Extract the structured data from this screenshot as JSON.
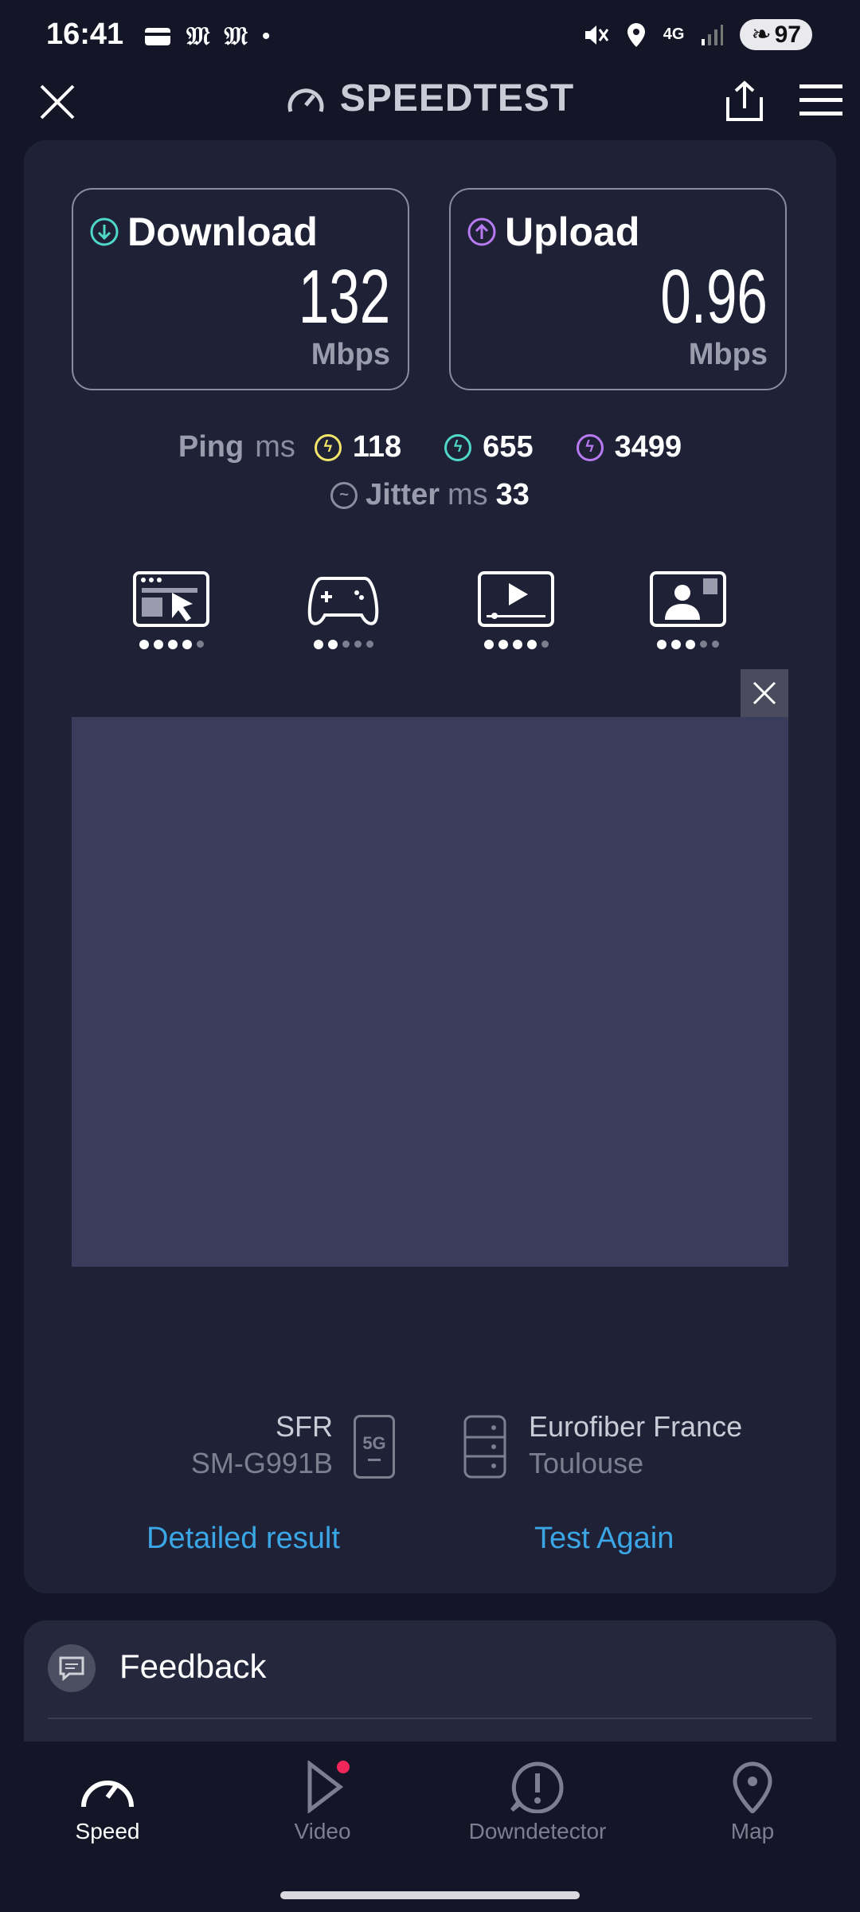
{
  "status": {
    "time": "16:41",
    "battery": "97",
    "network": "4G"
  },
  "header": {
    "title": "SPEEDTEST"
  },
  "download": {
    "label": "Download",
    "value": "132",
    "unit": "Mbps"
  },
  "upload": {
    "label": "Upload",
    "value": "0.96",
    "unit": "Mbps"
  },
  "ping": {
    "label": "Ping",
    "unit": "ms",
    "idle": "118",
    "download": "655",
    "upload": "3499"
  },
  "jitter": {
    "label": "Jitter",
    "unit": "ms",
    "value": "33"
  },
  "quality": {
    "browsing": 4,
    "gaming": 2,
    "streaming": 4,
    "video_chat": 3,
    "max": 5
  },
  "provider": {
    "name": "SFR",
    "device": "SM-G991B",
    "tech": "5G"
  },
  "server": {
    "name": "Eurofiber France",
    "location": "Toulouse"
  },
  "actions": {
    "detailed": "Detailed result",
    "again": "Test Again"
  },
  "feedback": {
    "label": "Feedback"
  },
  "nav": [
    {
      "label": "Speed"
    },
    {
      "label": "Video"
    },
    {
      "label": "Downdetector"
    },
    {
      "label": "Map"
    }
  ],
  "colors": {
    "accent": "#3aa6e6",
    "download": "#4fd8c8",
    "upload": "#b77af0",
    "ping": "#f2e66a"
  }
}
